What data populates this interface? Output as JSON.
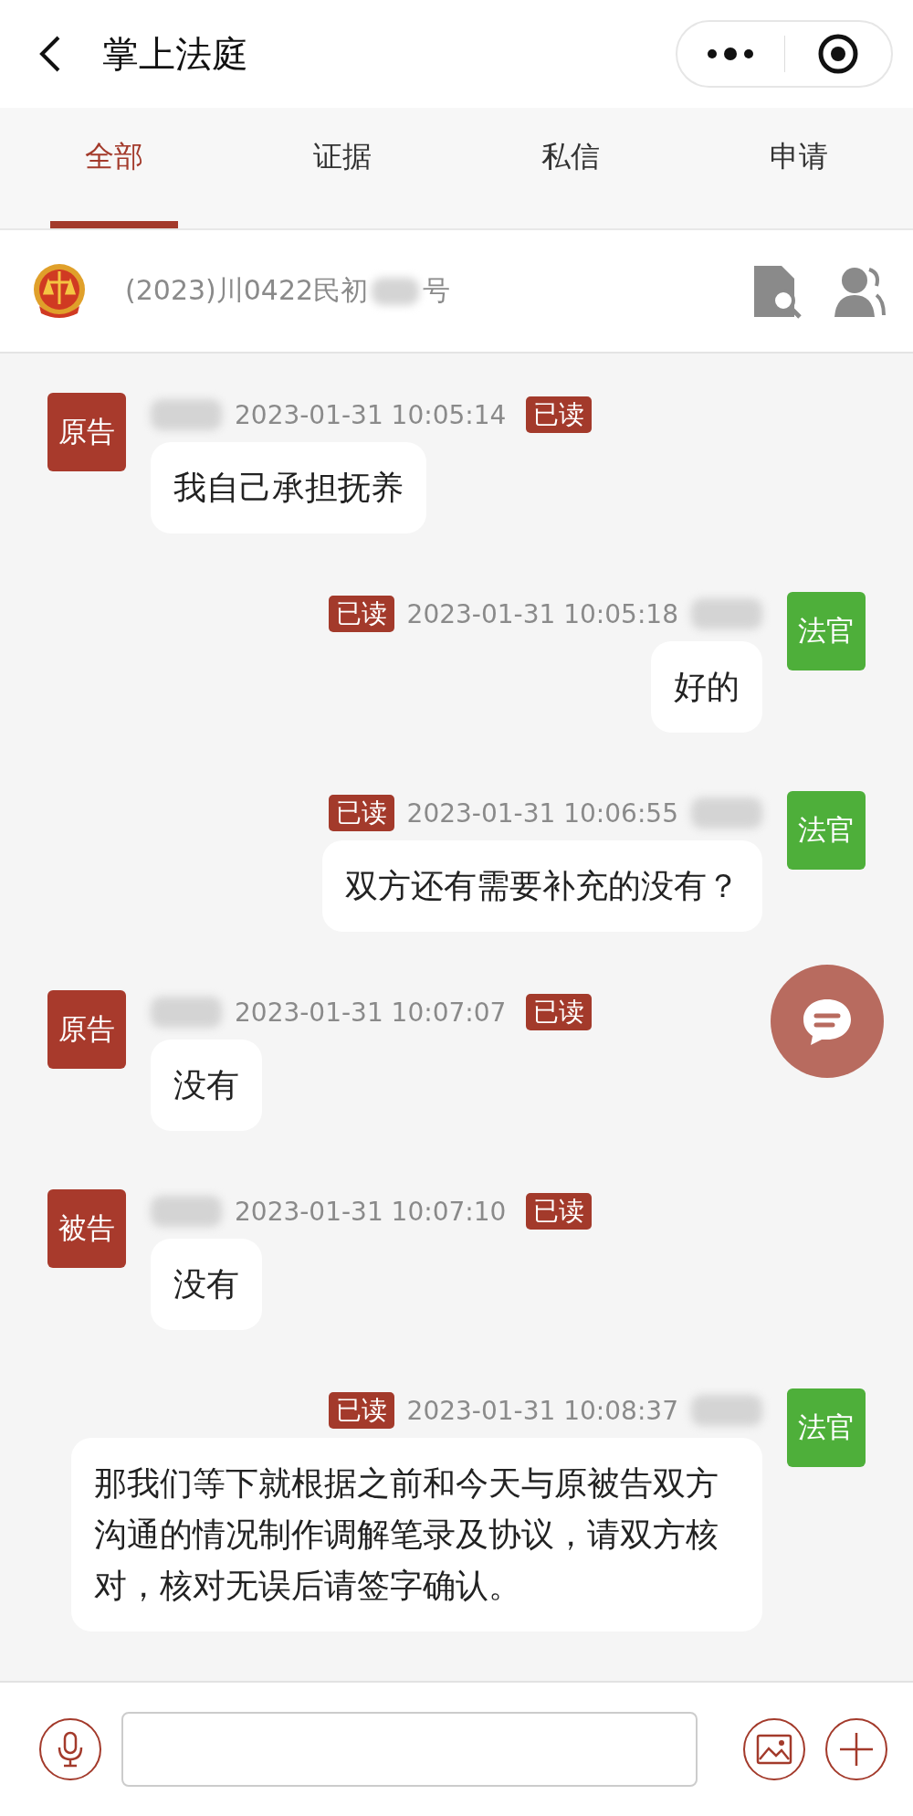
{
  "header": {
    "title": "掌上法庭"
  },
  "tabs": [
    {
      "label": "全部",
      "selected": true
    },
    {
      "label": "证据",
      "selected": false
    },
    {
      "label": "私信",
      "selected": false
    },
    {
      "label": "申请",
      "selected": false
    }
  ],
  "case": {
    "number": "(2023)川0422民初",
    "suffix": "号"
  },
  "messages": [
    {
      "kind": "left",
      "role": "原告",
      "color": "#a83a2c",
      "time": "2023-01-31 10:05:14",
      "status": "已读",
      "text": "我自己承担抚养"
    },
    {
      "kind": "right",
      "role": "法官",
      "color": "#4eaf3a",
      "time": "2023-01-31 10:05:18",
      "status": "已读",
      "text": "好的"
    },
    {
      "kind": "right",
      "role": "法官",
      "color": "#4eaf3a",
      "time": "2023-01-31 10:06:55",
      "status": "已读",
      "text": "双方还有需要补充的没有？"
    },
    {
      "kind": "left",
      "role": "原告",
      "color": "#a83a2c",
      "time": "2023-01-31 10:07:07",
      "status": "已读",
      "text": "没有"
    },
    {
      "kind": "left",
      "role": "被告",
      "color": "#a83a2c",
      "time": "2023-01-31 10:07:10",
      "status": "已读",
      "text": "没有"
    },
    {
      "kind": "right",
      "role": "法官",
      "color": "#4eaf3a",
      "time": "2023-01-31 10:08:37",
      "status": "已读",
      "text": "那我们等下就根据之前和今天与原被告双方沟通的情况制作调解笔录及协议，请双方核对，核对无误后请签字确认。"
    }
  ]
}
